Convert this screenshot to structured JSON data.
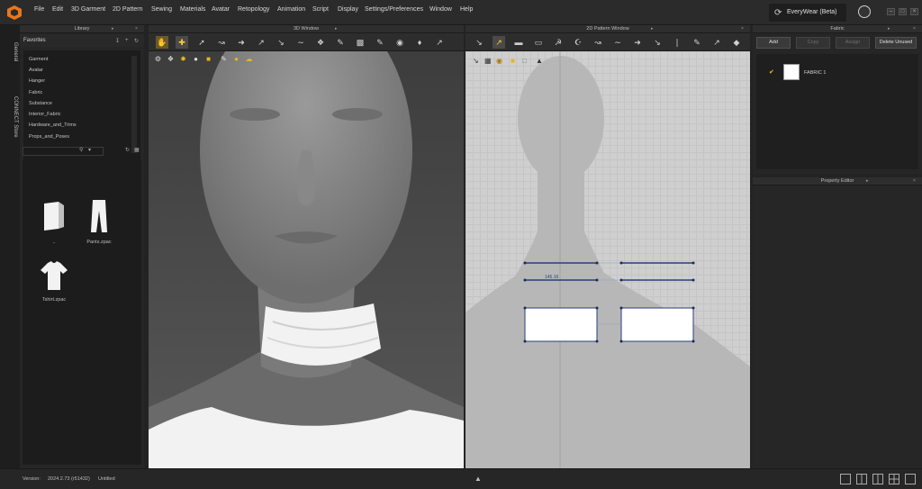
{
  "menu": {
    "items": [
      "File",
      "Edit",
      "3D Garment",
      "2D Pattern",
      "Sewing",
      "Materials",
      "Avatar",
      "Retopology",
      "Animation",
      "Script",
      "Display",
      "Settings/Preferences",
      "Window",
      "Help"
    ]
  },
  "brand": {
    "label": "EveryWear (Beta)"
  },
  "side_tabs": {
    "general": "General",
    "connect": "CONNECT Store"
  },
  "library": {
    "title": "Library",
    "favorites_label": "Favorites",
    "favorites": [
      "Garment",
      "Avatar",
      "Hanger",
      "Fabric",
      "Substance",
      "Interior_Fabric",
      "Hardware_and_Trims",
      "Props_and_Poses"
    ],
    "items": [
      {
        "label": "..",
        "icon": "folder-up-icon"
      },
      {
        "label": "Pants.zpac",
        "icon": "pants-icon"
      },
      {
        "label": "Tshirt.zpac",
        "icon": "tshirt-icon"
      }
    ]
  },
  "window3d": {
    "title": "3D Window"
  },
  "window2d": {
    "title": "2D Pattern Window",
    "dimension_label": "145.16"
  },
  "fabric": {
    "title": "Fabric",
    "buttons": {
      "add": "Add",
      "copy": "Copy",
      "assign": "Assign",
      "delete_unused": "Delete Unused"
    },
    "items": [
      {
        "name": "FABRIC 1",
        "checked": true
      }
    ]
  },
  "property_editor": {
    "title": "Property Editor"
  },
  "status": {
    "version_label": "Version:",
    "version": "2024.2.73 (r51432)",
    "file": "Untitled"
  },
  "colors": {
    "accent_check": "#e6c02a",
    "logo": "#e8771c",
    "pattern_stroke": "#2a3f7a",
    "canvas_bg": "#cfcfcf"
  }
}
